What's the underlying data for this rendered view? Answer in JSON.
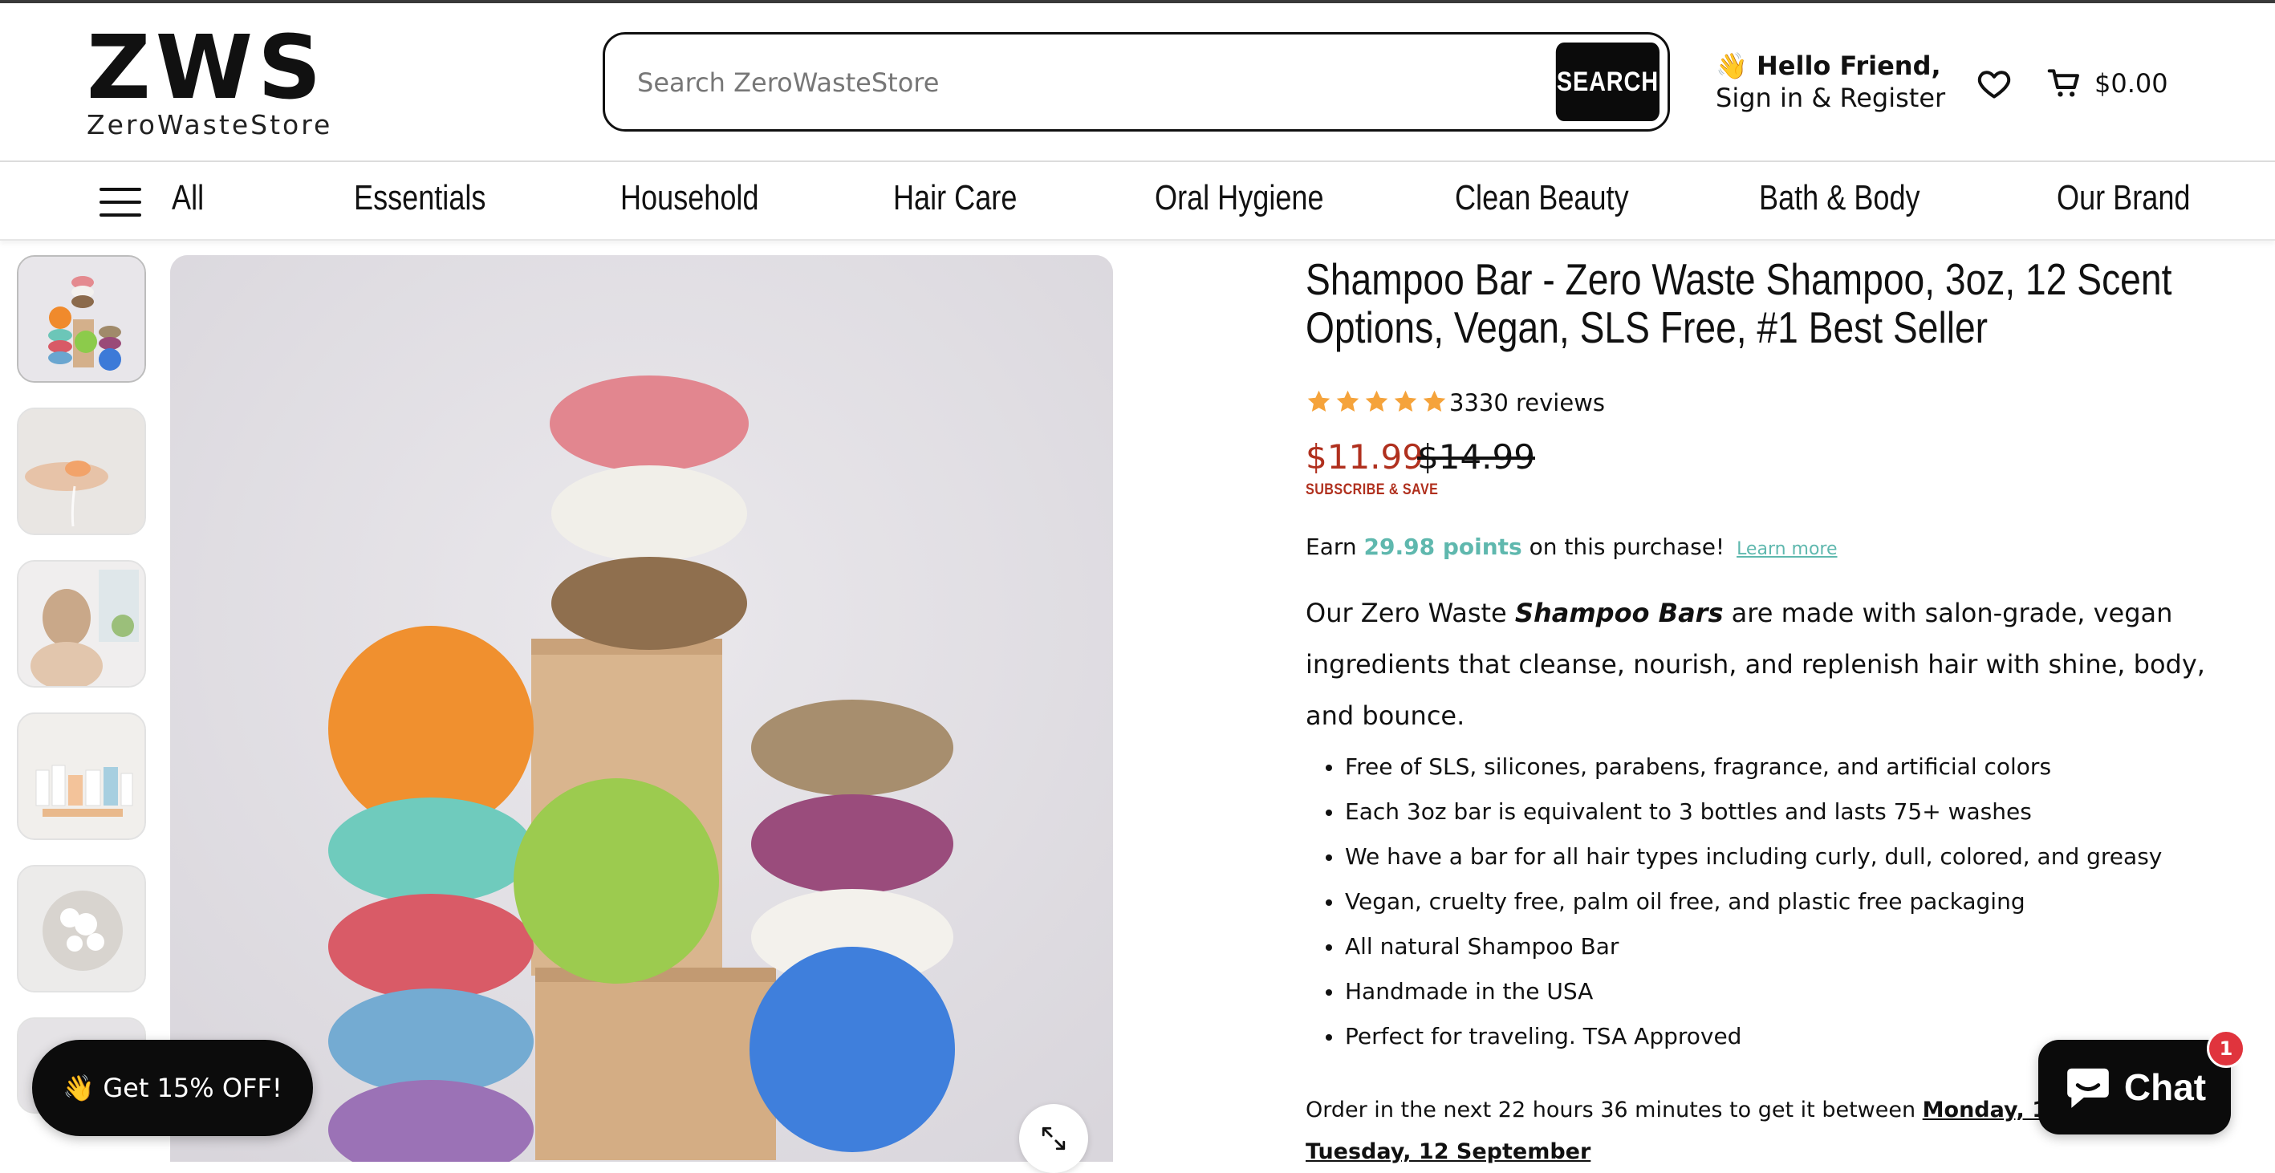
{
  "brand": {
    "logo_mark": "ZWS",
    "logo_text": "ZeroWasteStore"
  },
  "search": {
    "placeholder": "Search ZeroWasteStore",
    "button_label": "SEARCH"
  },
  "account": {
    "greeting": "👋 Hello Friend,",
    "link": "Sign in & Register"
  },
  "cart": {
    "total": "$0.00"
  },
  "nav": {
    "menu_label": "All",
    "items": [
      "Essentials",
      "Household",
      "Hair Care",
      "Oral Hygiene",
      "Clean Beauty",
      "Bath & Body",
      "Our Brand"
    ]
  },
  "product": {
    "title": "Shampoo Bar - Zero Waste Shampoo, 3oz, 12 Scent Options, Vegan, SLS Free, #1 Best Seller",
    "rating": 5,
    "reviews_label": "3330 reviews",
    "price": "$11.99",
    "compare_price": "$14.99",
    "subscribe_label": "SUBSCRIBE & SAVE",
    "earn": {
      "prefix": "Earn",
      "points": "29.98 points",
      "suffix": "on this purchase!",
      "learn_more": "Learn more"
    },
    "description": {
      "prefix": "Our Zero Waste",
      "emphasis": "Shampoo Bars",
      "suffix": "are made with salon-grade, vegan ingredients that cleanse, nourish, and replenish hair with shine, body, and bounce."
    },
    "bullets": [
      "Free of SLS, silicones, parabens, fragrance, and artificial colors",
      "Each 3oz bar is equivalent to 3 bottles and lasts 75+ washes",
      "We have a bar for all hair types including curly, dull, colored, and greasy",
      "Vegan, cruelty free, palm oil free, and plastic free packaging",
      "All natural Shampoo Bar",
      "Handmade in the USA",
      "Perfect for traveling. TSA Approved"
    ],
    "delivery": {
      "prefix": "Order in the next 22 hours 36 minutes to get it between",
      "date_start": "Monday, 11 Sep",
      "date_end": "Tuesday, 12 September"
    }
  },
  "gallery": {
    "thumbnails": [
      "product-stack",
      "hand-with-bar",
      "woman-washing-hair",
      "product-boxes",
      "lather-in-hair",
      "partial-thumbnail"
    ]
  },
  "promo": {
    "label": "👋 Get 15% OFF!"
  },
  "chat": {
    "label": "Chat",
    "badge": "1"
  },
  "colors": {
    "price_red": "#b0301e",
    "points_teal": "#5fb8ae",
    "star_orange": "#f5a33b",
    "badge_red": "#e0343d",
    "ink": "#111111"
  }
}
